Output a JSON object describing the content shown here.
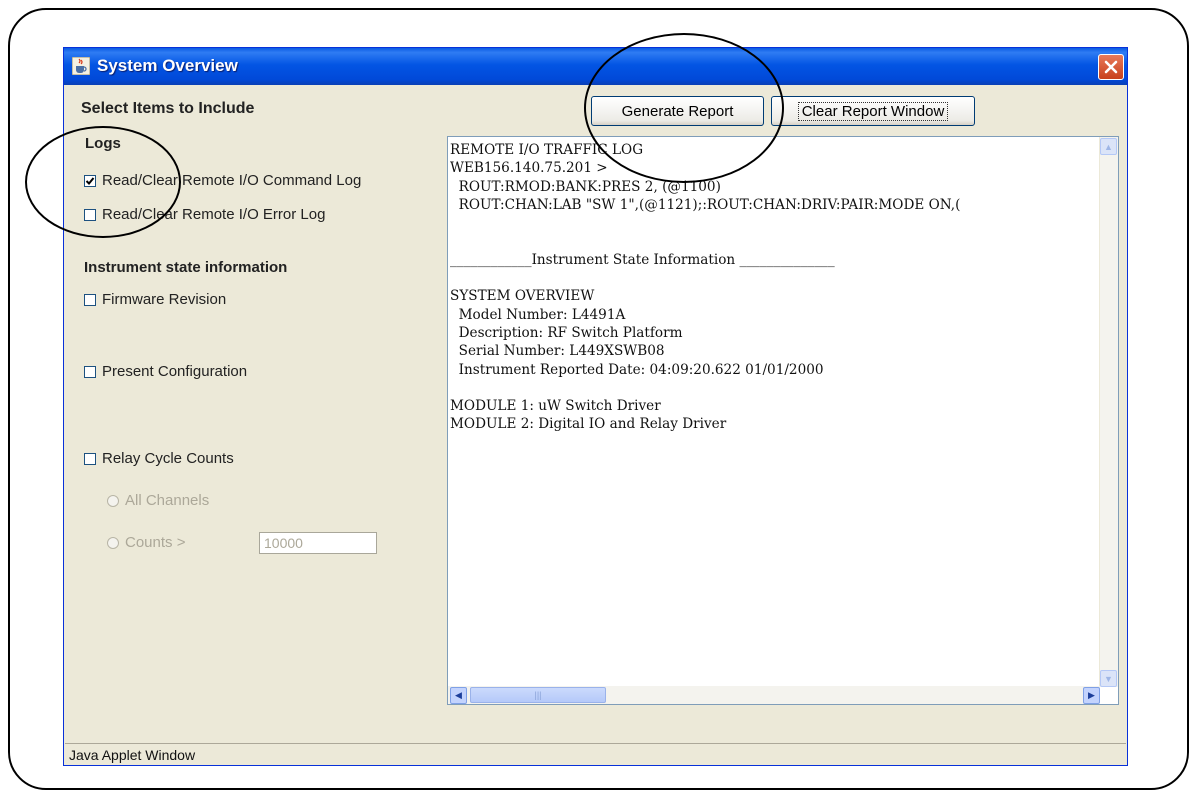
{
  "window": {
    "title": "System Overview",
    "status_text": "Java Applet Window"
  },
  "left_panel": {
    "heading": "Select Items to Include",
    "logs_label": "Logs",
    "logs": [
      {
        "label": "Read/Clear Remote I/O Command Log",
        "checked": true
      },
      {
        "label": "Read/Clear Remote I/O Error Log",
        "checked": false
      }
    ],
    "state_label": "Instrument state information",
    "state_items": [
      {
        "label": "Firmware Revision",
        "checked": false
      },
      {
        "label": "Present Configuration",
        "checked": false
      },
      {
        "label": "Relay Cycle Counts",
        "checked": false
      }
    ],
    "relay_options": {
      "all_channels": "All Channels",
      "counts": "Counts >",
      "counts_value": "10000"
    }
  },
  "toolbar": {
    "generate_label": "Generate Report",
    "clear_label": "Clear Report Window"
  },
  "report": {
    "lines": [
      "REMOTE I/O TRAFFIC LOG",
      "WEB156.140.75.201 >",
      "  ROUT:RMOD:BANK:PRES 2, (@1100)",
      "  ROUT:CHAN:LAB \"SW 1\",(@1121);:ROUT:CHAN:DRIV:PAIR:MODE ON,(",
      "",
      "",
      "____________Instrument State Information ______________",
      "",
      "SYSTEM OVERVIEW",
      "  Model Number: L4491A",
      "  Description: RF Switch Platform",
      "  Serial Number: L449XSWB08",
      "  Instrument Reported Date: 04:09:20.622 01/01/2000",
      "",
      "MODULE 1: uW Switch Driver",
      "MODULE 2: Digital IO and Relay Driver"
    ]
  },
  "icons": {
    "title": "java-cup-icon",
    "close": "close-icon"
  },
  "colors": {
    "titlebar": "#0355e4",
    "window_bg": "#ece9d8",
    "close_button": "#c8401c"
  }
}
